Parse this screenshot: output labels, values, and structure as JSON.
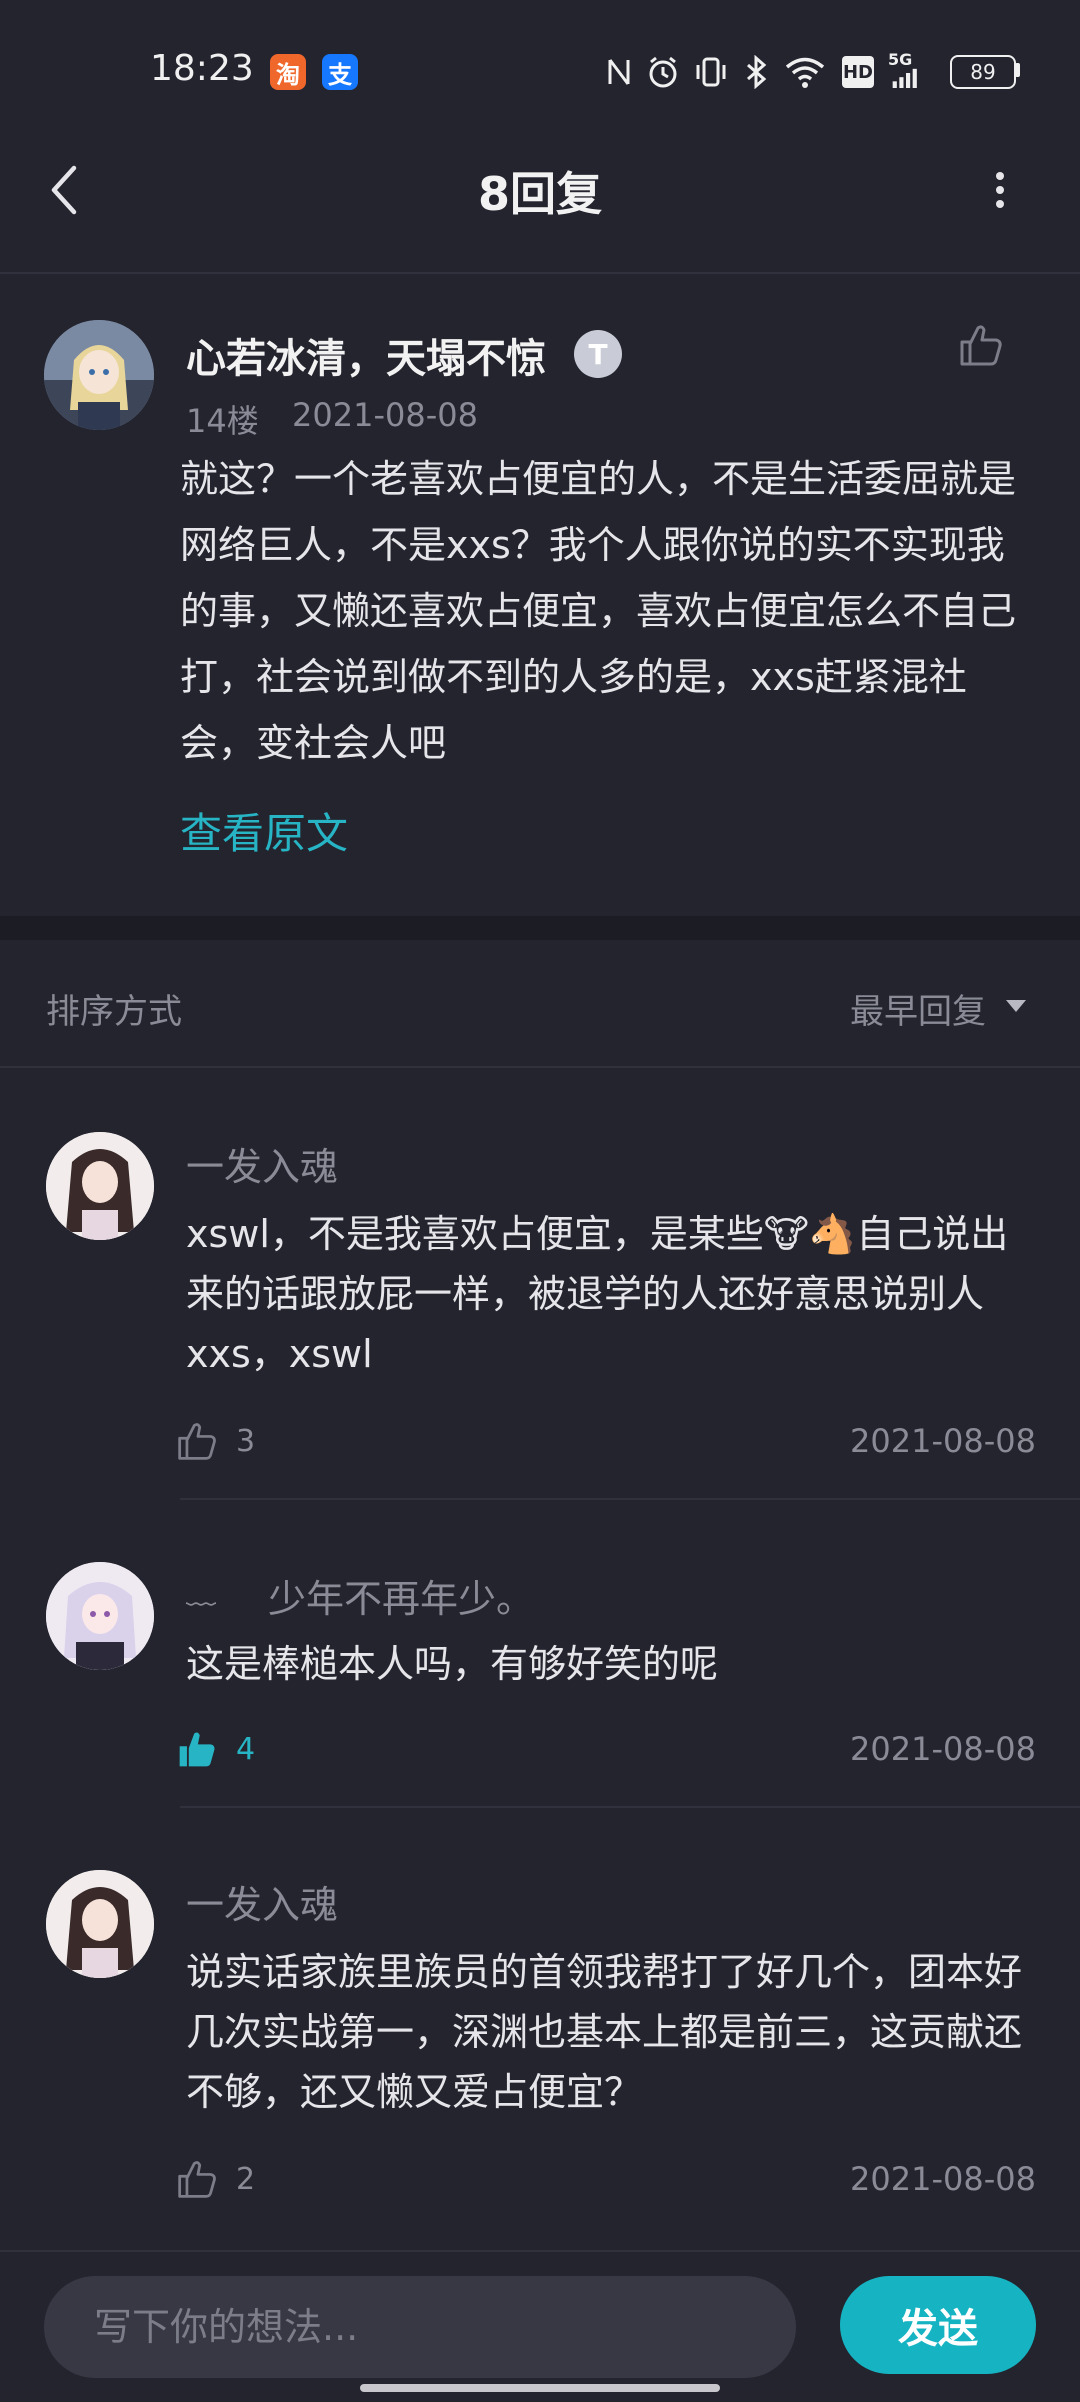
{
  "status_bar": {
    "time": "18:23",
    "app_badges": [
      {
        "text": "淘",
        "color": "#f0672b"
      },
      {
        "text": "支",
        "color": "#1677ff"
      }
    ],
    "network": "5G",
    "hd": "HD",
    "battery": "89"
  },
  "header": {
    "title": "8回复"
  },
  "main_post": {
    "author": "心若冰清，天塌不惊",
    "level_badge": "T",
    "floor": "14楼",
    "date": "2021-08-08",
    "content": "就这？一个老喜欢占便宜的人，不是生活委屈就是网络巨人，不是xxs？我个人跟你说的实不实现我的事，又懒还喜欢占便宜，喜欢占便宜怎么不自己打，社会说到做不到的人多的是，xxs赶紧混社会，变社会人吧",
    "view_original": "查看原文"
  },
  "sort": {
    "label": "排序方式",
    "value": "最早回复"
  },
  "replies": [
    {
      "author": "一发入魂",
      "content": "xswl，不是我喜欢占便宜，是某些🐮🐴自己说出来的话跟放屁一样，被退学的人还好意思说别人xxs，xswl",
      "likes": "3",
      "liked": false,
      "date": "2021-08-08"
    },
    {
      "author_prefix": "﹏",
      "author": "少年不再年少。",
      "content": "这是棒槌本人吗，有够好笑的呢",
      "likes": "4",
      "liked": true,
      "date": "2021-08-08"
    },
    {
      "author": "一发入魂",
      "content": "说实话家族里族员的首领我帮打了好几个，团本好几次实战第一，深渊也基本上都是前三，这贡献还不够，还又懒又爱占便宜？",
      "likes": "2",
      "liked": false,
      "date": "2021-08-08"
    }
  ],
  "composer": {
    "placeholder": "写下你的想法...",
    "send_label": "发送"
  },
  "colors": {
    "background": "#23242e",
    "accent": "#16b4c3",
    "muted_text": "#8a8b96"
  }
}
